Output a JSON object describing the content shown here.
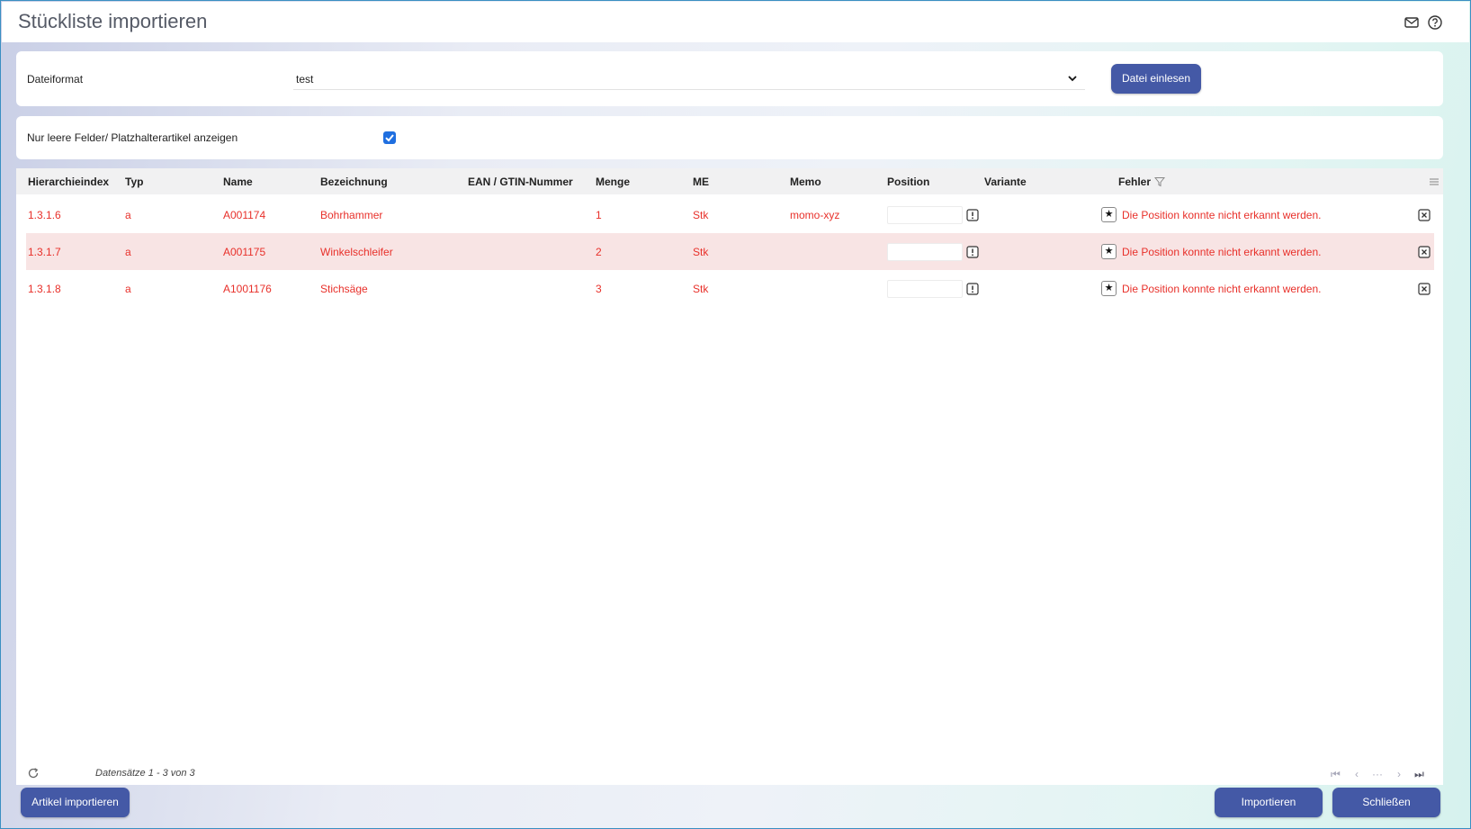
{
  "window": {
    "title": "Stückliste importieren",
    "icons": [
      "mail-icon",
      "help-icon"
    ]
  },
  "format_panel": {
    "label": "Dateiformat",
    "selected": "test",
    "read_button": "Datei einlesen"
  },
  "filter_panel": {
    "label": "Nur leere Felder/ Platzhalterartikel anzeigen",
    "checked": true
  },
  "table": {
    "columns": [
      "Hierarchieindex",
      "Typ",
      "Name",
      "Bezeichnung",
      "EAN / GTIN-Nummer",
      "Menge",
      "ME",
      "Memo",
      "Position",
      "Variante",
      "Fehler"
    ],
    "rows": [
      {
        "index": "1.3.1.6",
        "typ": "a",
        "name": "A001174",
        "bezeichnung": "Bohrhammer",
        "ean": "",
        "menge": "1",
        "me": "Stk",
        "memo": "momo-xyz",
        "position": "",
        "variante": "",
        "fehler": "Die Position konnte nicht erkannt werden."
      },
      {
        "index": "1.3.1.7",
        "typ": "a",
        "name": "A001175",
        "bezeichnung": "Winkelschleifer",
        "ean": "",
        "menge": "2",
        "me": "Stk",
        "memo": "",
        "position": "",
        "variante": "",
        "fehler": "Die Position konnte nicht erkannt werden."
      },
      {
        "index": "1.3.1.8",
        "typ": "a",
        "name": "A1001176",
        "bezeichnung": "Stichsäge",
        "ean": "",
        "menge": "3",
        "me": "Stk",
        "memo": "",
        "position": "",
        "variante": "",
        "fehler": "Die Position konnte nicht erkannt werden."
      }
    ],
    "footer": "Datensätze 1 - 3 von 3",
    "pager": {
      "first": "⏮",
      "prev": "‹",
      "more": "···",
      "next": "›",
      "last": "⏭"
    }
  },
  "actions": {
    "import_articles": "Artikel importieren",
    "import": "Importieren",
    "close": "Schließen"
  },
  "colors": {
    "accent": "#4459a6",
    "error_text": "#e8302a",
    "row_highlight": "#f8e4e4"
  }
}
